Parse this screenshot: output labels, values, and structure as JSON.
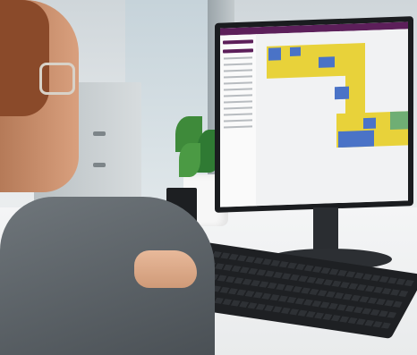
{
  "scene": {
    "description_tag": "office-desk-monitor",
    "colors": {
      "app_titlebar": "#5c1f5a",
      "room_yellow": "#e8d23a",
      "room_blue": "#4a73c7",
      "room_green": "#6fae74"
    },
    "icons": [
      "monitor-icon",
      "keyboard-icon",
      "plant-icon",
      "mug-icon"
    ]
  }
}
